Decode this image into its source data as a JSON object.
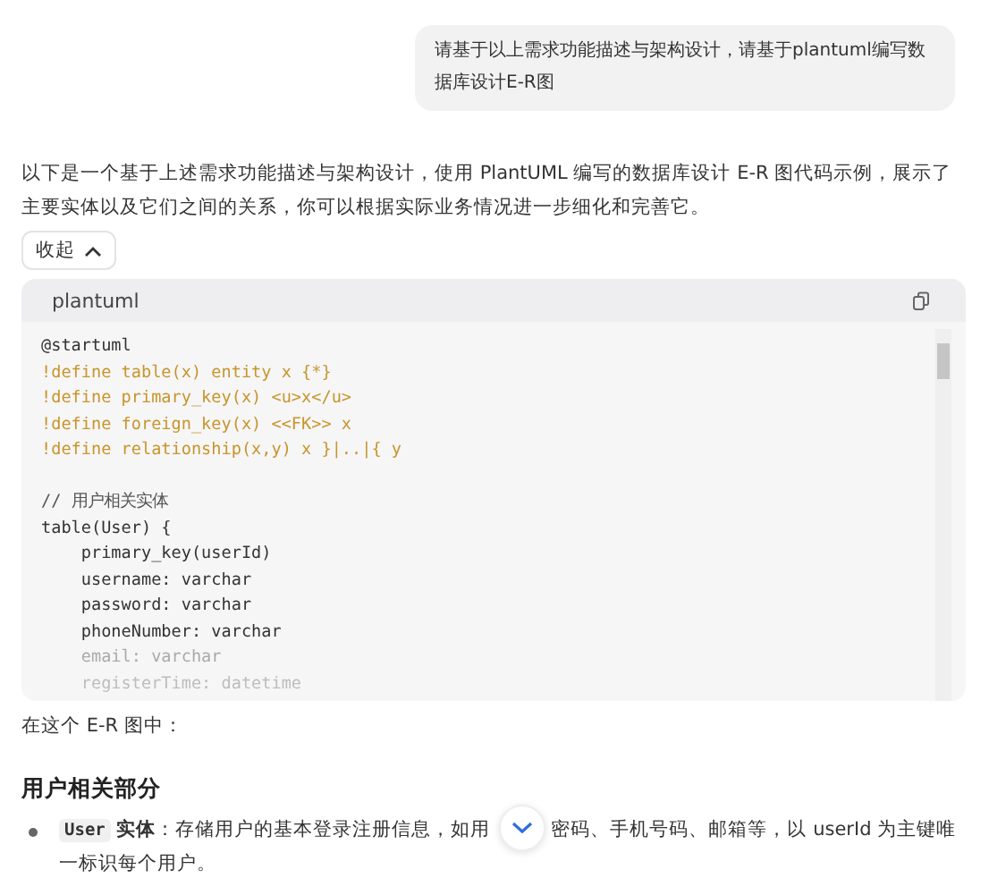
{
  "user_message": "请基于以上需求功能描述与架构设计，请基于plantuml编写数据库设计E-R图",
  "intro": "以下是一个基于上述需求功能描述与架构设计，使用 PlantUML 编写的数据库设计 E-R 图代码示例，展示了主要实体以及它们之间的关系，你可以根据实际业务情况进一步细化和完善它。",
  "collapse_button": {
    "label": "收起",
    "expanded": true
  },
  "code_block": {
    "language": "plantuml",
    "lines": [
      {
        "kind": "plain",
        "text": "@startuml"
      },
      {
        "kind": "directive",
        "text": "!define table(x) entity x {*}"
      },
      {
        "kind": "directive",
        "text": "!define primary_key(x) <u>x</u>"
      },
      {
        "kind": "directive",
        "text": "!define foreign_key(x) <<FK>> x"
      },
      {
        "kind": "directive",
        "text": "!define relationship(x,y) x }|..|{ y"
      },
      {
        "kind": "blank"
      },
      {
        "kind": "comment",
        "text": "// 用户相关实体"
      },
      {
        "kind": "plain",
        "text": "table(User) {"
      },
      {
        "kind": "plain",
        "text": "    primary_key(userId)"
      },
      {
        "kind": "plain",
        "text": "    username: varchar"
      },
      {
        "kind": "plain",
        "text": "    password: varchar"
      },
      {
        "kind": "plain",
        "text": "    phoneNumber: varchar"
      },
      {
        "kind": "faded",
        "text": "    email: varchar"
      },
      {
        "kind": "faint",
        "text": "    registerTime: datetime"
      }
    ]
  },
  "summary": "在这个 E-R 图中：",
  "section_heading": "用户相关部分",
  "bullets": [
    {
      "code": "User",
      "term": "实体",
      "text_before": "：存储用户的基本登录注册信息，如用",
      "text_after": "密码、手机号码、邮箱等，以 userId 为主键唯一标识每个用户。"
    }
  ]
}
